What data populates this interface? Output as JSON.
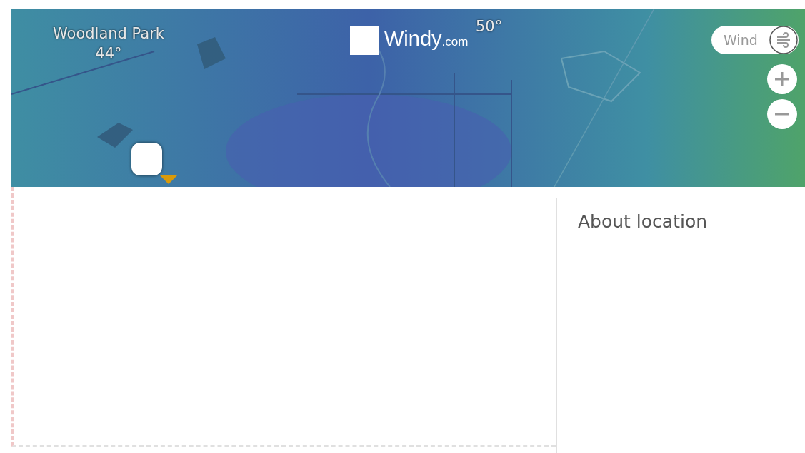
{
  "map": {
    "places": [
      {
        "name": "Woodland Park",
        "temperature": "44°"
      },
      {
        "temperature": "50°"
      }
    ],
    "logo": {
      "name": "Windy",
      "suffix": ".com"
    },
    "layer_toggle": {
      "label": "Wind"
    }
  },
  "sidebar": {
    "title": "About location"
  }
}
